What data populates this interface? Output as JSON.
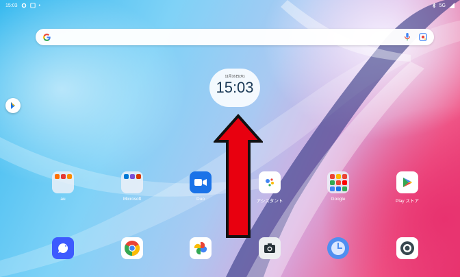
{
  "status_bar": {
    "time": "15:03",
    "signal": "5G"
  },
  "search": {
    "placeholder": ""
  },
  "clock": {
    "date": "11月16日(木)",
    "time": "15:03"
  },
  "apps_row1": [
    {
      "label": "au"
    },
    {
      "label": "Microsoft"
    },
    {
      "label": "Duo"
    },
    {
      "label": "アシスタント"
    },
    {
      "label": "Google"
    },
    {
      "label": "Play ストア"
    }
  ],
  "colors": {
    "duo": "#1a73e8",
    "arrow_fill": "#e8000f",
    "arrow_stroke": "#111111",
    "messages": "#3d5afe",
    "clock_app": "#4f8ff0"
  }
}
